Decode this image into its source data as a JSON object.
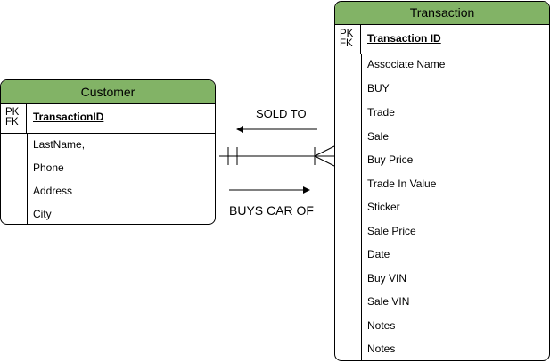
{
  "customer": {
    "title": "Customer",
    "key_label": "PK\nFK",
    "pk_field": "TransactionID",
    "fields": [
      "LastName,",
      "Phone",
      "Address",
      "City"
    ]
  },
  "transaction": {
    "title": "Transaction",
    "key_label": "PK\nFK",
    "pk_field": "Transaction ID",
    "first_field": "Associate Name",
    "fields": [
      "BUY",
      "Trade",
      "Sale",
      "Buy Price",
      "Trade In Value",
      "Sticker",
      "Sale Price",
      "Date",
      "Buy VIN",
      "Sale VIN",
      "Notes",
      "Notes"
    ]
  },
  "relationships": {
    "sold_to": "SOLD TO",
    "buys_car_of": "BUYS CAR OF"
  },
  "colors": {
    "header_fill": "#82b366",
    "stroke": "#000000"
  }
}
